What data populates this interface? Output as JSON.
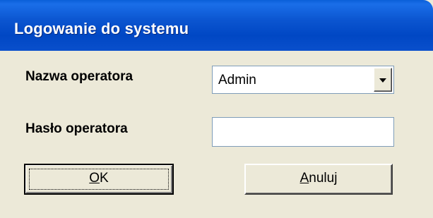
{
  "window": {
    "title": "Logowanie do systemu"
  },
  "form": {
    "operator_name_label": "Nazwa operatora",
    "operator_password_label": "Hasło operatora",
    "operator_name_value": "Admin",
    "operator_password_value": ""
  },
  "buttons": {
    "ok": {
      "mnemonic": "O",
      "rest": "K"
    },
    "cancel": {
      "mnemonic": "A",
      "rest": "nuluj"
    }
  },
  "icons": {
    "dropdown": "chevron-down-icon"
  },
  "colors": {
    "titlebar": "#0a55d0",
    "dialog_bg": "#ece9d8",
    "field_border": "#7f9db9"
  }
}
